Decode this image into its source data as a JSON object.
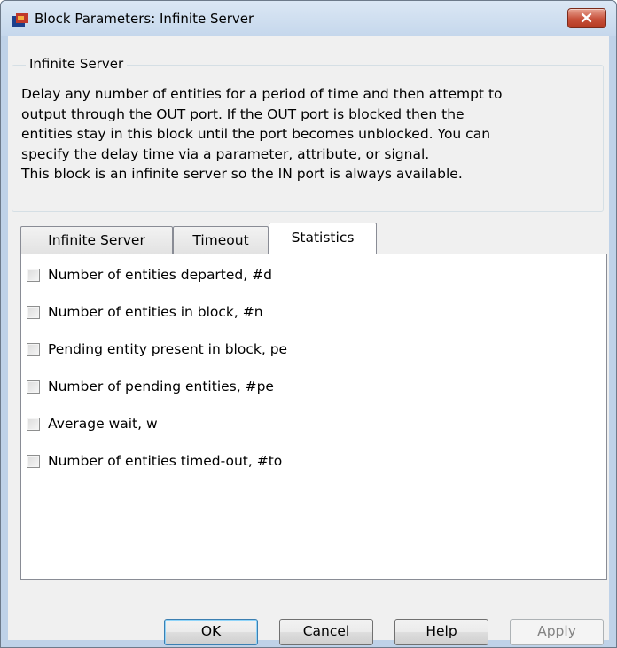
{
  "window": {
    "title": "Block Parameters: Infinite Server"
  },
  "group": {
    "title": "Infinite Server",
    "description_lines": [
      "Delay any number of entities for a period of time and then attempt to",
      "output through the OUT port. If the OUT port is blocked then the",
      "entities stay in this block until the port becomes unblocked. You can",
      "specify the delay time via a parameter, attribute, or signal.",
      "This block is an infinite server so the IN port is always available."
    ]
  },
  "tabs": [
    {
      "label": "Infinite Server",
      "active": false
    },
    {
      "label": "Timeout",
      "active": false
    },
    {
      "label": "Statistics",
      "active": true
    }
  ],
  "statistics": [
    {
      "label": "Number of entities departed, #d",
      "checked": false
    },
    {
      "label": "Number of entities in block, #n",
      "checked": false
    },
    {
      "label": "Pending entity present in block, pe",
      "checked": false
    },
    {
      "label": "Number of pending entities, #pe",
      "checked": false
    },
    {
      "label": "Average wait, w",
      "checked": false
    },
    {
      "label": "Number of entities timed-out, #to",
      "checked": false
    }
  ],
  "buttons": {
    "ok": "OK",
    "cancel": "Cancel",
    "help": "Help",
    "apply": "Apply"
  },
  "icons": {
    "app": "simulink-block-icon",
    "close": "close-icon"
  }
}
